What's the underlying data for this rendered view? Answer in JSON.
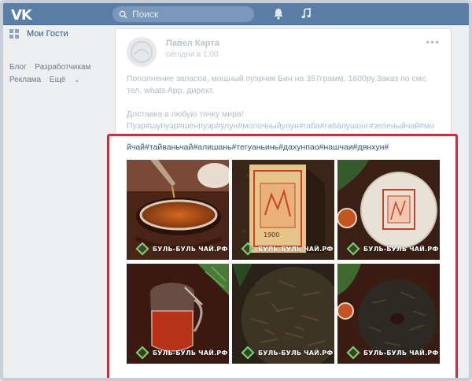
{
  "header": {
    "logo": "VK",
    "search_placeholder": "Поиск",
    "icons": [
      "bell-icon",
      "music-icon"
    ]
  },
  "left_menu": {
    "items": [
      {
        "label": "Мои Гости",
        "icon": "grid-icon"
      }
    ],
    "footer": {
      "blog": "Блог",
      "developers": "Разработчикам",
      "ads": "Реклама",
      "more": "Ещё"
    }
  },
  "post": {
    "author": "Павел Карта",
    "time": "сегодня в 1:00",
    "paragraph1": "Пополнение запасов, мощный пуэрчик Бин на 357грамм. 1600ру.Заказ по смс, тел, whats App, директ.",
    "paragraph2": "Доставка в любую точку мира!",
    "tags_line1": "Пуэр#шупуэр#шенпуэр#улун#молочныйулун#габа#габалушонг#зеленыйчай#мо",
    "tags_line2": "йчай#тайваньчай#алишань#тегуаньинь#дахунпао#нашчаи#дянхун#"
  },
  "photos": {
    "watermark": "БУЛЬ-БУЛЬ ЧАЙ.РФ",
    "wrapper_text": "1900"
  },
  "colors": {
    "header": "#5b7ea6",
    "link": "#2a5885",
    "highlight": "#d8283a"
  }
}
